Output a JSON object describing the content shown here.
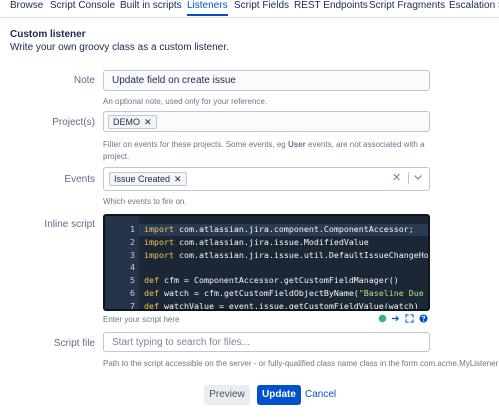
{
  "tabs": [
    {
      "label": "Browse",
      "active": false
    },
    {
      "label": "Script Console",
      "active": false
    },
    {
      "label": "Built in scripts",
      "active": false
    },
    {
      "label": "Listeners",
      "active": true
    },
    {
      "label": "Script Fields",
      "active": false
    },
    {
      "label": "REST Endpoints",
      "active": false
    },
    {
      "label": "Script Fragments",
      "active": false
    },
    {
      "label": "Escalation S",
      "active": false
    }
  ],
  "section": {
    "title": "Custom listener",
    "description": "Write your own groovy class as a custom listener."
  },
  "note": {
    "label": "Note",
    "value": "Update field on create issue",
    "help": "An optional note, used only for your reference."
  },
  "projects": {
    "label": "Project(s)",
    "tags": [
      "DEMO"
    ],
    "help_prefix": "Filter on events for these projects. Some events, eg ",
    "help_bold": "User",
    "help_suffix": " events, are not associated with a project."
  },
  "events": {
    "label": "Events",
    "tags": [
      "Issue Created"
    ],
    "clear_glyph": "✕",
    "help": "Which events to fire on."
  },
  "inline_script": {
    "label": "Inline script",
    "lines": [
      {
        "n": "1",
        "parts": [
          {
            "t": "import",
            "c": "kw"
          },
          {
            "t": " com.atlassian.jira.component.ComponentAccessor;",
            "c": ""
          }
        ]
      },
      {
        "n": "2",
        "parts": [
          {
            "t": "import",
            "c": "kw"
          },
          {
            "t": " com.atlassian.jira.issue.ModifiedValue",
            "c": ""
          }
        ]
      },
      {
        "n": "3",
        "parts": [
          {
            "t": "import",
            "c": "kw"
          },
          {
            "t": " com.atlassian.jira.issue.util.DefaultIssueChangeHo",
            "c": ""
          }
        ]
      },
      {
        "n": "4",
        "parts": []
      },
      {
        "n": "5",
        "parts": [
          {
            "t": "def",
            "c": "kw"
          },
          {
            "t": " cfm = ComponentAccessor.getCustomFieldManager()",
            "c": ""
          }
        ]
      },
      {
        "n": "6",
        "parts": [
          {
            "t": "def",
            "c": "kw"
          },
          {
            "t": " watch = cfm.getCustomFieldObjectByName(",
            "c": ""
          },
          {
            "t": "\"Baseline Due",
            "c": "str"
          }
        ]
      },
      {
        "n": "7",
        "parts": [
          {
            "t": "def",
            "c": "kw"
          },
          {
            "t": " watchValue = event.issue.getCustomFieldValue(watch)",
            "c": ""
          }
        ]
      }
    ],
    "help": "Enter your script here"
  },
  "script_file": {
    "label": "Script file",
    "placeholder": "Start typing to search for files...",
    "help": "Path to the script accessible on the server - or fully-qualified class name class in the form com.acme.MyListener"
  },
  "buttons": {
    "preview": "Preview",
    "update": "Update",
    "cancel": "Cancel"
  },
  "colors": {
    "accent": "#0052cc",
    "editor_bg": "#1b2636",
    "status_ok": "#36b37e"
  }
}
